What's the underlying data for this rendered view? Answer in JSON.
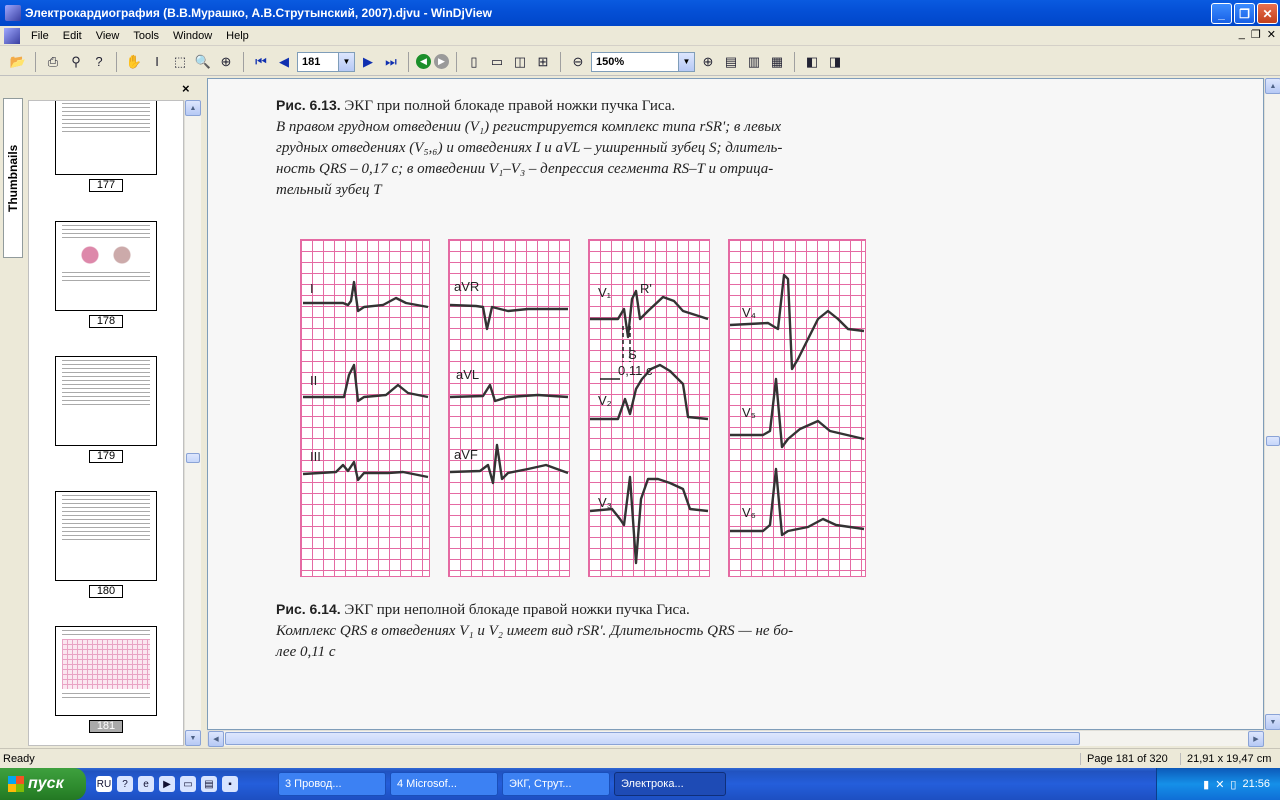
{
  "window": {
    "title": "Электрокардиография (В.В.Мурашко, А.В.Струтынский, 2007).djvu - WinDjView"
  },
  "menu": {
    "items": [
      "File",
      "Edit",
      "View",
      "Tools",
      "Window",
      "Help"
    ]
  },
  "toolbar": {
    "page_value": "181",
    "zoom_value": "150%"
  },
  "sidebar": {
    "tab_label": "Thumbnails",
    "close": "×",
    "thumbnails": [
      {
        "page": "177",
        "selected": false
      },
      {
        "page": "178",
        "selected": false
      },
      {
        "page": "179",
        "selected": false
      },
      {
        "page": "180",
        "selected": false
      },
      {
        "page": "181",
        "selected": true
      }
    ]
  },
  "document": {
    "caption1": {
      "title": "Рис. 6.13.",
      "title_text": "ЭКГ при полной блокаде правой ножки пучка Гиса.",
      "line1": "В правом грудном отведении (V₁) регистрируется комплекс типа rSR'; в левых",
      "line2": "грудных отведениях (V₅,₆) и отведениях I и aVL – уширенный зубец S; длитель-",
      "line3": "ность QRS – 0,17 с; в отведении V₁–V₃ – депрессия сегмента RS–T и отрица-",
      "line4": "тельный зубец T"
    },
    "leads": {
      "I": "I",
      "II": "II",
      "III": "III",
      "aVR": "aVR",
      "aVL": "aVL",
      "aVF": "aVF",
      "V1": "V₁",
      "V2": "V₂",
      "V3": "V₃",
      "V4": "V₄",
      "V5": "V₅",
      "V6": "V₆",
      "R_prime": "R'",
      "S": "S",
      "interval": "0,11 с"
    },
    "caption2": {
      "title": "Рис. 6.14.",
      "title_text": "ЭКГ при неполной блокаде правой ножки пучка Гиса.",
      "line1": "Комплекс QRS в отведениях V₁ и V₂ имеет вид rSR'. Длительность QRS — не бо-",
      "line2": "лее 0,11 с"
    }
  },
  "status": {
    "ready": "Ready",
    "page_info": "Page 181 of 320",
    "size_info": "21,91 x 19,47 cm"
  },
  "taskbar": {
    "start_label": "пуск",
    "lang": "RU",
    "tasks": [
      {
        "label": "3 Провод...",
        "active": false
      },
      {
        "label": "4 Microsof...",
        "active": false
      },
      {
        "label": "ЭКГ, Струт...",
        "active": false
      },
      {
        "label": "Электрока...",
        "active": true
      }
    ],
    "clock": "21:56"
  }
}
